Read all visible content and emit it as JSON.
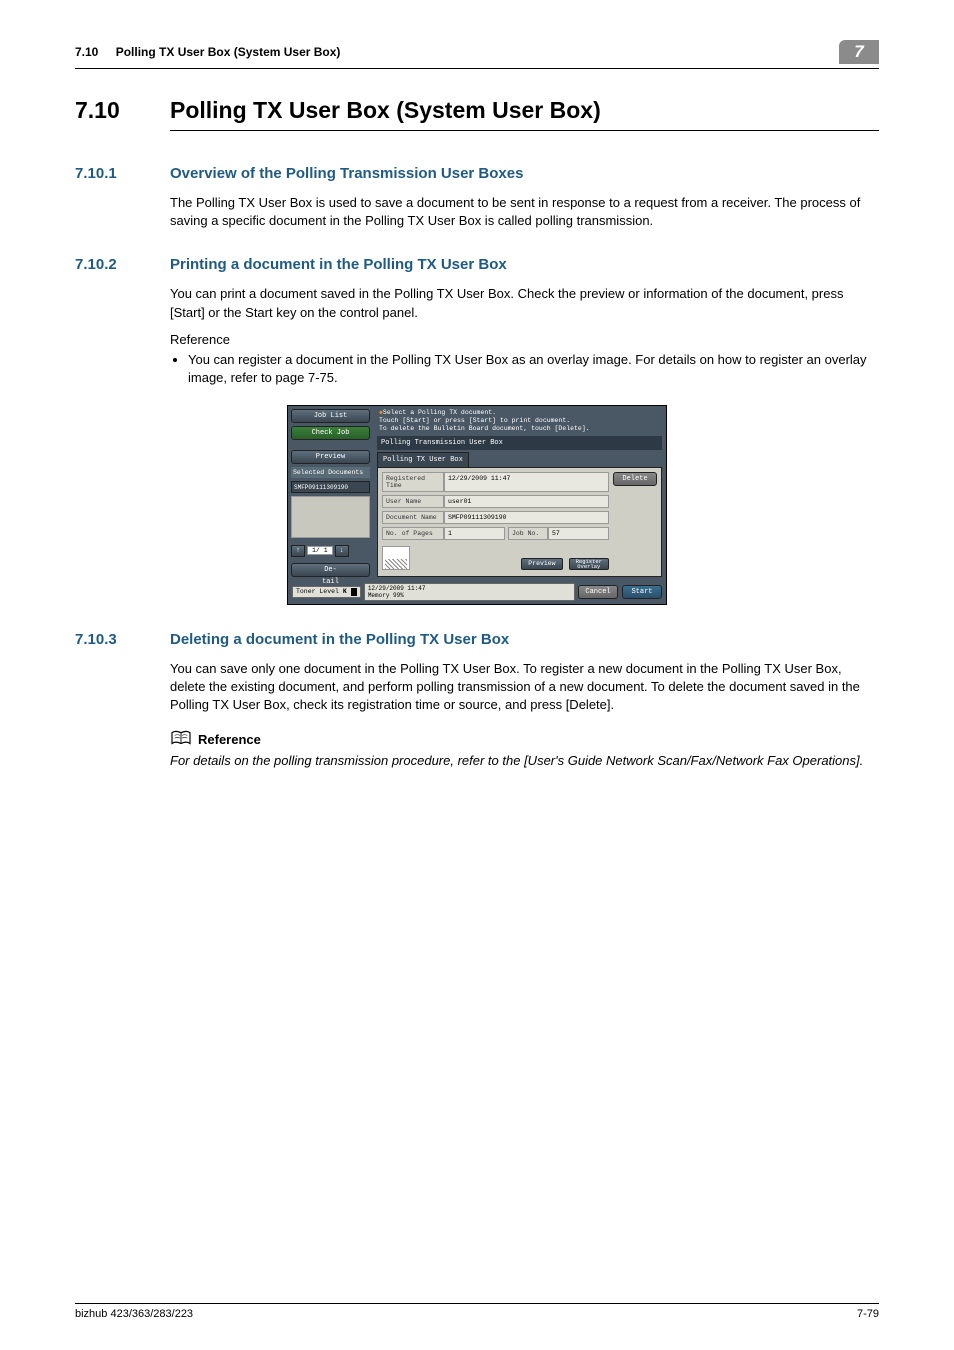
{
  "header": {
    "section_num": "7.10",
    "section_title": "Polling TX User Box (System User Box)",
    "chapter": "7"
  },
  "h1": {
    "num": "7.10",
    "title": "Polling TX User Box (System User Box)"
  },
  "sec1": {
    "num": "7.10.1",
    "title": "Overview of the Polling Transmission User Boxes",
    "body": "The Polling TX User Box is used to save a document to be sent in response to a request from a receiver. The process of saving a specific document in the Polling TX User Box is called polling transmission."
  },
  "sec2": {
    "num": "7.10.2",
    "title": "Printing a document in the Polling TX User Box",
    "body": "You can print a document saved in the Polling TX User Box. Check the preview or information of the document, press [Start] or the Start key on the control panel.",
    "ref_label": "Reference",
    "bullet1": "You can register a document in the Polling TX User Box as an overlay image. For details on how to register an overlay image, refer to page 7-75."
  },
  "sec3": {
    "num": "7.10.3",
    "title": "Deleting a document in the Polling TX User Box",
    "body": "You can save only one document in the Polling TX User Box. To register a new document in the Polling TX User Box, delete the existing document, and perform polling transmission of a new document. To delete the document saved in the Polling TX User Box, check its registration time or source, and press [Delete]."
  },
  "reference": {
    "heading": "Reference",
    "body": "For details on the polling transmission procedure, refer to the [User's Guide Network Scan/Fax/Network Fax Operations]."
  },
  "footer": {
    "model": "bizhub 423/363/283/223",
    "page": "7-79"
  },
  "screen": {
    "left": {
      "job_list": "Job List",
      "check_job": "Check Job",
      "preview": "Preview",
      "selected_header": "Selected Documents",
      "selected_item": "SMFP09111309190",
      "pager": "1/ 1",
      "detail": "De-\ntail"
    },
    "banner": {
      "l1": "Select a Polling TX document.",
      "l2": "Touch [Start] or press [Start] to print document.",
      "l3": "To delete the Bulletin Board document, touch [Delete]."
    },
    "tab": "Polling Transmission User Box",
    "subtab": "Polling TX User Box",
    "info": {
      "reg_time_label": "Registered\nTime",
      "reg_time_val": "12/29/2009 11:47",
      "user_label": "User Name",
      "user_val": "user01",
      "doc_label": "Document Name",
      "doc_val": "SMFP09111309190",
      "pages_label": "No. of Pages",
      "pages_val": "1",
      "jobno_label": "Job No.",
      "jobno_val": "57"
    },
    "actions": {
      "delete": "Delete",
      "preview": "Preview",
      "register": "Register\nOverlay",
      "cancel": "Cancel",
      "start": "Start"
    },
    "footer": {
      "toner": "Toner Level",
      "toner_k": "K",
      "datetime": "12/29/2009   11:47",
      "memory": "Memory        99%"
    }
  }
}
